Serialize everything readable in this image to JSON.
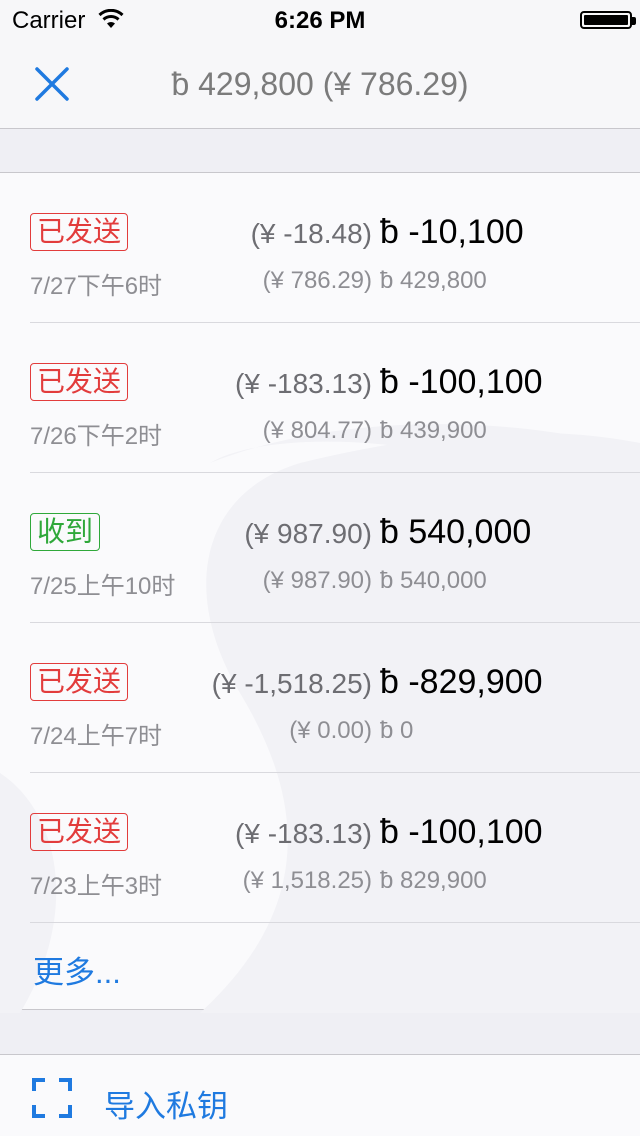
{
  "status_bar": {
    "carrier": "Carrier",
    "time": "6:26 PM"
  },
  "nav": {
    "close_icon": "close-icon",
    "title": "ƀ 429,800 (¥ 786.29)"
  },
  "transactions": [
    {
      "status": "已发送",
      "type": "sent",
      "date": "7/27下午6时",
      "fiat": "(¥ -18.48)",
      "amount": "ƀ -10,100",
      "balance_fiat": "(¥ 786.29)",
      "balance": "ƀ 429,800"
    },
    {
      "status": "已发送",
      "type": "sent",
      "date": "7/26下午2时",
      "fiat": "(¥ -183.13)",
      "amount": "ƀ -100,100",
      "balance_fiat": "(¥ 804.77)",
      "balance": "ƀ 439,900"
    },
    {
      "status": "收到",
      "type": "received",
      "date": "7/25上午10时",
      "fiat": "(¥ 987.90)",
      "amount": "ƀ 540,000",
      "balance_fiat": "(¥ 987.90)",
      "balance": "ƀ 540,000"
    },
    {
      "status": "已发送",
      "type": "sent",
      "date": "7/24上午7时",
      "fiat": "(¥ -1,518.25)",
      "amount": "ƀ -829,900",
      "balance_fiat": "(¥ 0.00)",
      "balance": "ƀ 0"
    },
    {
      "status": "已发送",
      "type": "sent",
      "date": "7/23上午3时",
      "fiat": "(¥ -183.13)",
      "amount": "ƀ -100,100",
      "balance_fiat": "(¥ 1,518.25)",
      "balance": "ƀ 829,900"
    }
  ],
  "more_label": "更多...",
  "import": {
    "icon": "scan-icon",
    "label": "导入私钥"
  },
  "colors": {
    "sent": "#e23c3c",
    "received": "#2fa83a",
    "accent": "#1f7ae0"
  }
}
